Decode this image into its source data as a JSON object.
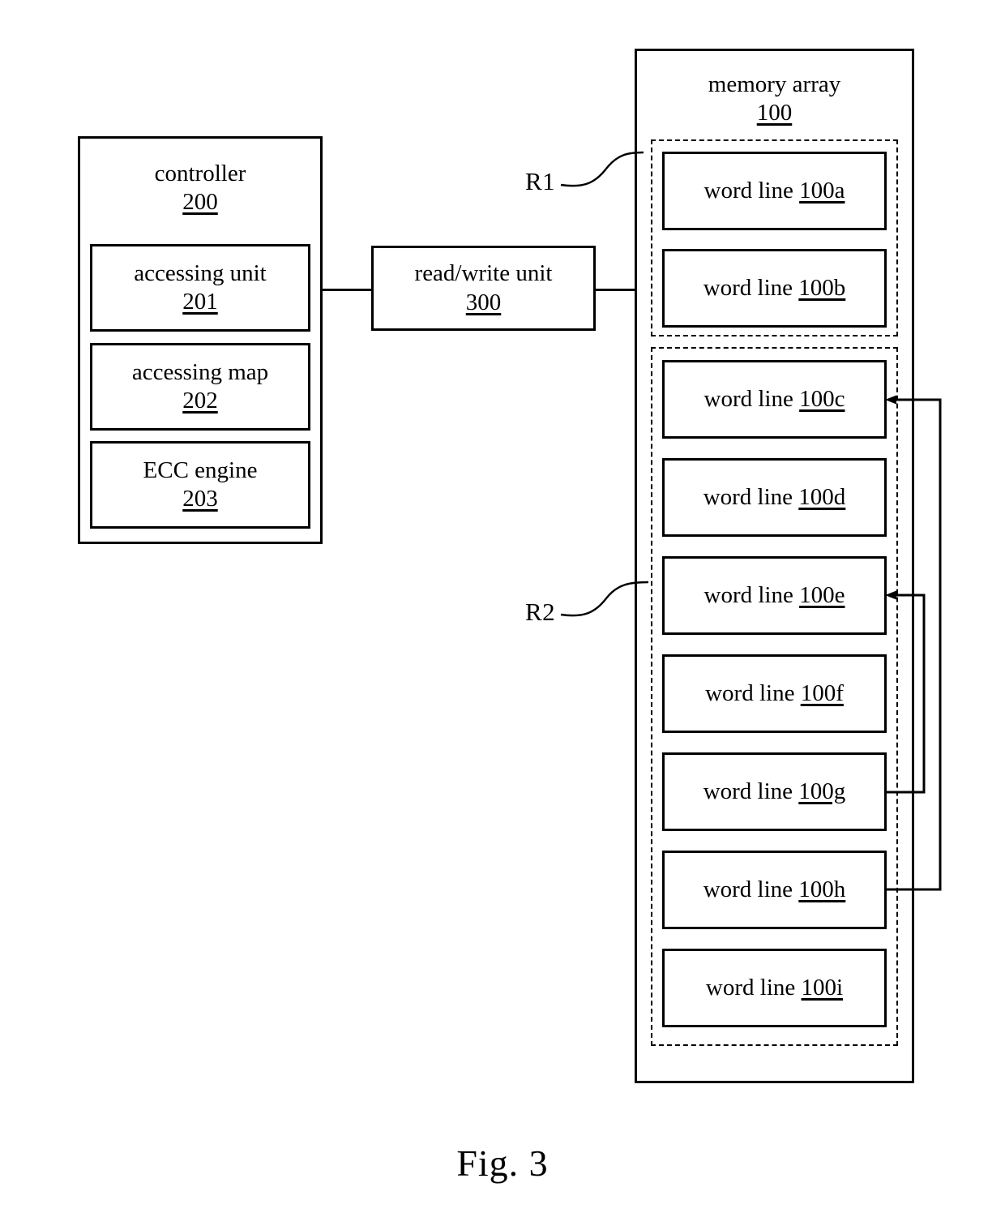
{
  "figure": {
    "caption": "Fig. 3"
  },
  "controller": {
    "title": "controller",
    "ref": "200",
    "blocks": [
      {
        "label": "accessing unit",
        "ref": "201",
        "name": "accessing-unit"
      },
      {
        "label": "accessing map",
        "ref": "202",
        "name": "accessing-map"
      },
      {
        "label": "ECC engine",
        "ref": "203",
        "name": "ecc-engine"
      }
    ]
  },
  "read_write_unit": {
    "label": "read/write unit",
    "ref": "300"
  },
  "memory_array": {
    "title": "memory array",
    "ref": "100",
    "regions": [
      {
        "tag": "R1",
        "word_lines": [
          {
            "label": "word line",
            "ref": "100a"
          },
          {
            "label": "word line",
            "ref": "100b"
          }
        ]
      },
      {
        "tag": "R2",
        "word_lines": [
          {
            "label": "word line",
            "ref": "100c"
          },
          {
            "label": "word line",
            "ref": "100d"
          },
          {
            "label": "word line",
            "ref": "100e"
          },
          {
            "label": "word line",
            "ref": "100f"
          },
          {
            "label": "word line",
            "ref": "100g"
          },
          {
            "label": "word line",
            "ref": "100h"
          },
          {
            "label": "word line",
            "ref": "100i"
          }
        ]
      }
    ]
  },
  "connections": [
    {
      "from": "accessing unit 201",
      "to": "read/write unit 300",
      "arrow": "none"
    },
    {
      "from": "read/write unit 300",
      "to": "memory array 100",
      "arrow": "none"
    },
    {
      "from": "word line 100g",
      "to": "word line 100e",
      "arrow": "to"
    },
    {
      "from": "word line 100h",
      "to": "word line 100c",
      "arrow": "to"
    }
  ],
  "colors": {
    "stroke": "#000000",
    "background": "#ffffff"
  }
}
